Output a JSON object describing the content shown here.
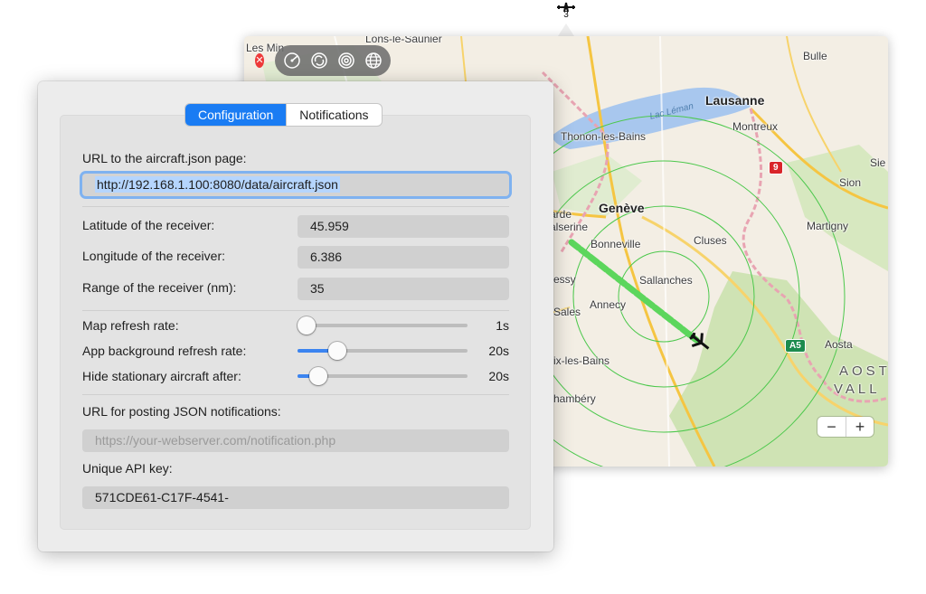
{
  "status_item": {
    "icon": "airplane-icon",
    "count": "3"
  },
  "map": {
    "labels": {
      "les_mines": "Les Min",
      "lons": "Lons-le-Saunier",
      "bulle": "Bulle",
      "lausanne": "Lausanne",
      "montreux": "Montreux",
      "lac_leman": "Lac Léman",
      "thonon": "Thonon-les-Bains",
      "sierre": "Sie",
      "sion": "Sion",
      "arde": "arde",
      "geneve": "Genève",
      "alserine": "alserine",
      "martigny": "Martigny",
      "bonneville": "Bonneville",
      "cluses": "Cluses",
      "essy": "essy",
      "sallanches": "Sallanches",
      "annecy": "Annecy",
      "sales": "Sales",
      "aosta": "Aosta",
      "aix": "ix-les-Bains",
      "aosta_region_1": "AOST",
      "aosta_region_2": "VALL",
      "chambery": "hambéry"
    },
    "shields": {
      "road_9": "9",
      "road_a5": "A5"
    },
    "zoom_out": "−",
    "zoom_in": "+"
  },
  "toolbar": {
    "close_icon": "close-icon",
    "tools": [
      "radar-icon",
      "refresh-icon",
      "target-icon",
      "globe-icon"
    ]
  },
  "tabs": {
    "configuration": "Configuration",
    "notifications": "Notifications",
    "active": "configuration"
  },
  "config": {
    "url_label": "URL to the aircraft.json page:",
    "url_value": "http://192.168.1.100:8080/data/aircraft.json",
    "latitude_label": "Latitude of the receiver:",
    "latitude_value": "45.959",
    "longitude_label": "Longitude of the receiver:",
    "longitude_value": "6.386",
    "range_label": "Range of the receiver (nm):",
    "range_value": "35",
    "map_refresh_label": "Map refresh rate:",
    "map_refresh_value": "1s",
    "map_refresh_level": 0.0,
    "bg_refresh_label": "App background refresh rate:",
    "bg_refresh_value": "20s",
    "bg_refresh_level": 0.2,
    "hide_label": "Hide stationary aircraft after:",
    "hide_value": "20s",
    "hide_level": 0.08,
    "notify_url_label": "URL for posting JSON notifications:",
    "notify_url_placeholder": "https://your-webserver.com/notification.php",
    "api_key_label": "Unique API key:",
    "api_key_value": "571CDE61-C17F-4541-"
  },
  "colors": {
    "accent": "#1a7cf3",
    "range_ring": "#4cc84c",
    "flight_track": "#5cd65c"
  }
}
